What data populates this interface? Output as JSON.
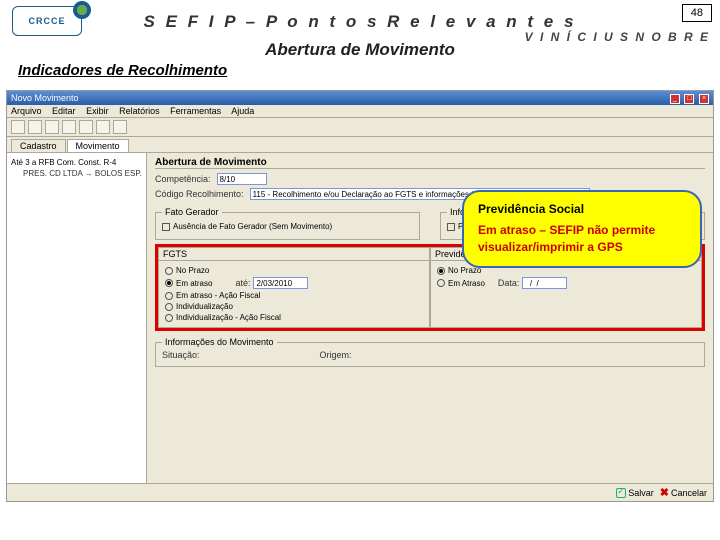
{
  "slide": {
    "logo_text": "CRCCE",
    "title": "S E F I P  –  P o n t o s   R e l e v a n t e s",
    "page_number": "48",
    "author": "V I N Í C I U S   N O B R E",
    "subtitle": "Abertura de Movimento",
    "section": "Indicadores de Recolhimento"
  },
  "app": {
    "window_title": "Novo Movimento",
    "menu": [
      "Arquivo",
      "Editar",
      "Exibir",
      "Relatórios",
      "Ferramentas",
      "Ajuda"
    ],
    "tabs": {
      "cadastro": "Cadastro",
      "movimento": "Movimento"
    },
    "panel_title": "Abertura de Movimento",
    "competencia_label": "Competência:",
    "competencia_value": "8/10",
    "codigo_label": "Código Recolhimento:",
    "codigo_value": "115 - Recolhimento e/ou Declaração ao FGTS e informações à Previdência Social",
    "fato_legend": "Fato Gerador",
    "fato_cb": "Ausência de Fato Gerador (Sem Movimento)",
    "info_ant_legend": "Informações Anteriores",
    "info_ant_cb": "Pedido de Exclusão de informações Anteriores",
    "fgts_title": "FGTS",
    "prev_title": "Previdência Social",
    "fgts_opts": {
      "no_prazo": "No Prazo",
      "em_atraso": "Em atraso",
      "ate_label": "até:",
      "ate_value": "2/03/2010",
      "acao_fiscal": "Em atraso - Ação Fiscal",
      "individ": "Individualização",
      "individ_fiscal": "Individualização - Ação Fiscal"
    },
    "prev_opts": {
      "no_prazo": "No Prazo",
      "em_atraso": "Em Atraso",
      "data_label": "Data:",
      "data_value": "  /  /"
    },
    "info_mov_legend": "Informações do Movimento",
    "situacao_label": "Situação:",
    "origem_label": "Origem:",
    "status_save": "Salvar",
    "status_cancel": "Cancelar"
  },
  "tree": {
    "root": "Até 3 a RFB Com. Const. R-4",
    "child": "PRES. CD LTDA → BOLOS ESP."
  },
  "callout": {
    "title": "Previdência Social",
    "body": "Em atraso – SEFIP não permite visualizar/imprimir a GPS"
  }
}
